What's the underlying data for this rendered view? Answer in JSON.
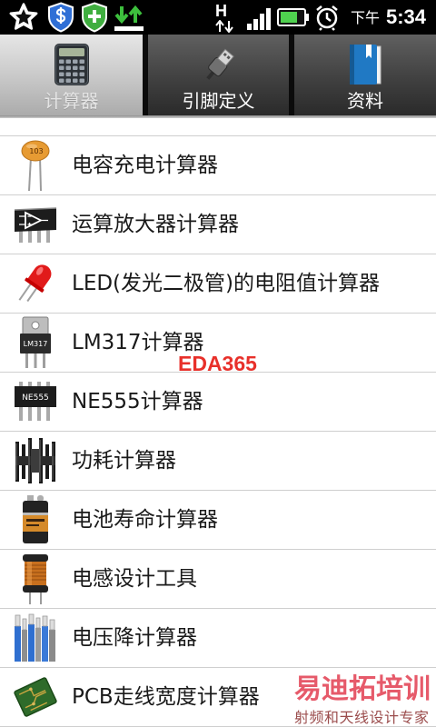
{
  "status_bar": {
    "left_icons": [
      "star-app-icon",
      "shield-dollar-icon",
      "shield-plus-icon",
      "download-upload-icon"
    ],
    "network_type": "H",
    "signal_level": 4,
    "signal_max": 4,
    "battery_level": 0.75,
    "ampm": "下午",
    "time": "5:34"
  },
  "tabs": [
    {
      "label": "计算器",
      "icon": "calculator-icon",
      "selected": true
    },
    {
      "label": "引脚定义",
      "icon": "usb-plug-icon",
      "selected": false
    },
    {
      "label": "资料",
      "icon": "book-icon",
      "selected": false
    }
  ],
  "list": {
    "items": [
      {
        "label": "电容充电计算器",
        "icon": "capacitor-icon",
        "icon_marking": "103"
      },
      {
        "label": "运算放大器计算器",
        "icon": "op-amp-chip-icon"
      },
      {
        "label": "LED(发光二极管)的电阻值计算器",
        "icon": "led-icon"
      },
      {
        "label": "LM317计算器",
        "icon": "lm317-regulator-icon",
        "icon_marking": "LM317"
      },
      {
        "label": "NE555计算器",
        "icon": "ne555-chip-icon",
        "icon_marking": "NE555"
      },
      {
        "label": "功耗计算器",
        "icon": "heatsink-icon"
      },
      {
        "label": "电池寿命计算器",
        "icon": "battery-9v-icon"
      },
      {
        "label": "电感设计工具",
        "icon": "inductor-icon"
      },
      {
        "label": "电压降计算器",
        "icon": "wires-icon"
      },
      {
        "label": "PCB走线宽度计算器",
        "icon": "pcb-icon"
      }
    ]
  },
  "watermarks": {
    "center": "EDA365",
    "brand": "易迪拓培训",
    "slogan": "射频和天线设计专家"
  },
  "colors": {
    "status_bar_bg": "#000000",
    "selected_tab": "#c2c2c2",
    "unselected_tab": "#3e3e3e",
    "separator": "#cfcfcf",
    "watermark_red": "#e8302a",
    "brand_red": "#e4495a"
  }
}
